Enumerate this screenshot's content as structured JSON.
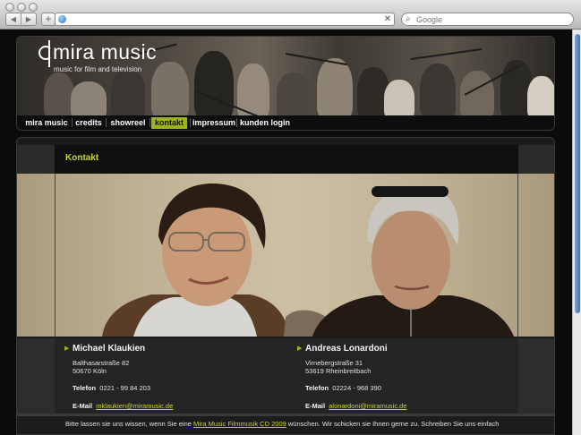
{
  "browser": {
    "url": "",
    "search_placeholder": "Google"
  },
  "header": {
    "logo_title": "mira music",
    "logo_subtitle": "music for film and television"
  },
  "nav": {
    "items": [
      {
        "label": "mira music"
      },
      {
        "label": "credits"
      },
      {
        "label": "showreel"
      },
      {
        "label": "kontakt",
        "active": true
      },
      {
        "label": "impressum"
      },
      {
        "label": "kunden login"
      }
    ]
  },
  "page": {
    "title": "Kontakt"
  },
  "contacts": [
    {
      "name": "Michael Klaukien",
      "street": "Balthasarstraße 82",
      "city": "50670 Köln",
      "phone_label": "Telefon",
      "phone": "0221 - 99 84 203",
      "email_label": "E-Mail",
      "email": "mklaukien@miramusic.de"
    },
    {
      "name": "Andreas Lonardoni",
      "street": "Virnebergstraße 31",
      "city": "53619 Rheinbreitbach",
      "phone_label": "Telefon",
      "phone": "02224 - 968 390",
      "email_label": "E-Mail",
      "email": "alonardoni@miramusic.de"
    }
  ],
  "footer": {
    "text_before": "Bitte lassen sie uns wissen, wenn Sie eine",
    "link": "Mira Music Filmmusik CD 2009",
    "text_after": "wünschen. Wir schicken sie Ihnen gerne zu. Schreiben Sie uns einfach"
  },
  "colors": {
    "accent": "#a0b419",
    "link": "#c7d62a",
    "background": "#0b0b0b"
  }
}
